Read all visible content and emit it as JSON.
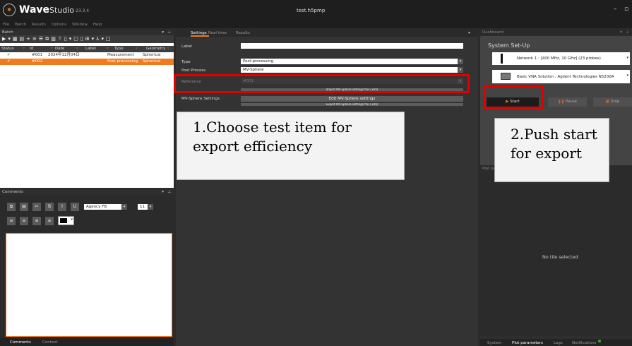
{
  "app": {
    "logo_text": "Wave",
    "logo_suffix": "Studio",
    "version": "23.3.4",
    "window_title": "test.h5pmp",
    "minimize_glyph": "–",
    "restore_glyph": "▫"
  },
  "menu": [
    "File",
    "Batch",
    "Results",
    "Options",
    "Window",
    "Help"
  ],
  "batch": {
    "panel_title": "Batch",
    "columns": [
      "Status",
      "Id",
      "Date",
      "Label",
      "Type",
      "Geometry"
    ],
    "rows": [
      {
        "status": "✔",
        "id": "#001",
        "date": "2024年12月04日",
        "label": "",
        "type": "Measurement",
        "geometry": "Spherical",
        "selected": false
      },
      {
        "status": "✔",
        "id": "#002",
        "date": "",
        "label": "",
        "type": "Post-processing",
        "geometry": "Spherical",
        "selected": true
      }
    ]
  },
  "comments": {
    "panel_title": "Comments",
    "font_name": "Agency FB",
    "font_size": "11",
    "tabs": [
      "Comments",
      "Context"
    ]
  },
  "settings": {
    "tabs": [
      "Settings",
      "Real time",
      "Results"
    ],
    "label_caption": "Label",
    "label_value": "",
    "type_caption": "Type",
    "type_value": "Post-processing",
    "post_process_caption": "Post Process",
    "post_process_value": "MV-Sphere",
    "reference_caption": "Reference",
    "reference_value": "#001",
    "mv_sphere_caption": "MV-Sphere Settings",
    "button_top_partial": "Import MV-Sphere settings file (.xml)",
    "edit_button": "Edit MV-Sphere settings",
    "export_button": "Export MV-Sphere settings file (.xml)"
  },
  "dashboard": {
    "panel_title": "Dashboard",
    "setup_title": "System Set-Up",
    "network": "Network 1 : [400 MHz, 10 GHz] (23 probes)",
    "vna": "Basic VNA Solution : Agilent Technologies N5230A",
    "start_label": "Start",
    "pause_label": "Pause",
    "stop_label": "Stop",
    "plot_panel_title": "Plot par",
    "no_tile": "No tile selected",
    "bottom_tabs": [
      "System",
      "Plot parameters",
      "Logs",
      "Notifications"
    ]
  },
  "annotations": {
    "step1_line1": "1.Choose test item for",
    "step1_line2": "export efficiency",
    "step2_line1": "2.Push start",
    "step2_line2": "for export"
  },
  "colors": {
    "accent_orange": "#f07a1e",
    "highlight_red": "#e00000",
    "dark_bg": "#2b2b2b",
    "title_bg": "#1e1e1e",
    "check_green": "#3aa82c"
  }
}
